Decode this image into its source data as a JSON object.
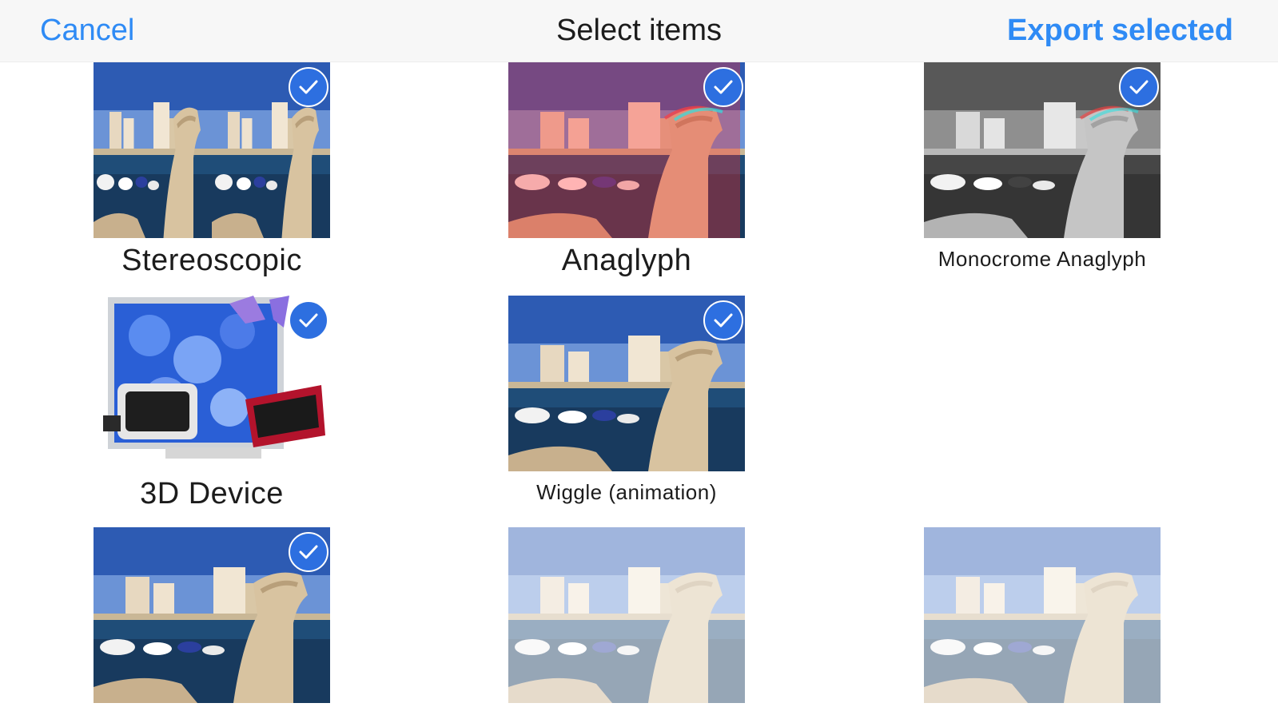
{
  "navbar": {
    "cancel_label": "Cancel",
    "title": "Select items",
    "export_label": "Export selected",
    "accent_color": "#2f8bf5"
  },
  "items": [
    {
      "label": "Stereoscopic",
      "selected": true,
      "image": "harbor-side-by-side"
    },
    {
      "label": "Anaglyph",
      "selected": true,
      "image": "harbor-anaglyph"
    },
    {
      "label": "Monocrome Anaglyph",
      "selected": true,
      "image": "harbor-anaglyph-grayscale"
    },
    {
      "label": "3D Device",
      "selected": true,
      "image": "3d-devices-illustration"
    },
    {
      "label": "Wiggle (animation)",
      "selected": true,
      "image": "harbor-photo"
    },
    {
      "label": "",
      "selected": true,
      "image": "harbor-photo"
    },
    {
      "label": "",
      "selected": false,
      "image": "harbor-photo-faded"
    },
    {
      "label": "",
      "selected": false,
      "image": "harbor-photo-faded"
    }
  ],
  "icons": {
    "check": "checkmark-icon"
  }
}
